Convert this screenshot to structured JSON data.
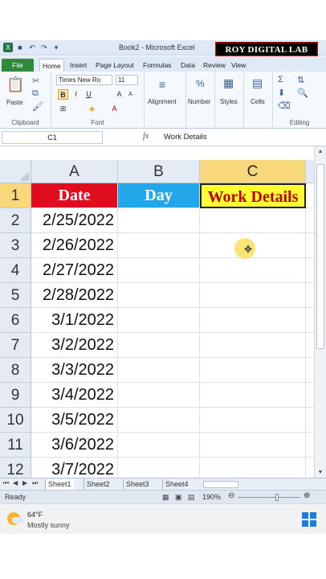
{
  "window": {
    "title": "Book2 - Microsoft Excel",
    "watermark": "ROY DIGITAL LAB"
  },
  "ribbon_tabs": [
    "File",
    "Home",
    "Insert",
    "Page Layout",
    "Formulas",
    "Data",
    "Review",
    "View"
  ],
  "ribbon": {
    "paste_label": "Paste",
    "clipboard_group": "Clipboard",
    "font_name": "Times New Ro",
    "font_size": "11",
    "font_group": "Font",
    "alignment_label": "Alignment",
    "number_label": "Number",
    "styles_label": "Styles",
    "cells_label": "Cells",
    "editing_group": "Editing"
  },
  "formula_bar": {
    "name_box": "C1",
    "fx": "fx",
    "content": "Work Details"
  },
  "columns": [
    "A",
    "B",
    "C"
  ],
  "rows": [
    "1",
    "2",
    "3",
    "4",
    "5",
    "6",
    "7",
    "8",
    "9",
    "10",
    "11",
    "12"
  ],
  "headers": {
    "a1": "Date",
    "b1": "Day",
    "c1": "Work Details"
  },
  "header_colors": {
    "a1_fill": "#e00d1e",
    "a1_text": "#ffffff",
    "b1_fill": "#22a7ea",
    "b1_text": "#ffffff",
    "c1_fill": "#ffff33",
    "c1_text": "#c00000"
  },
  "dates": [
    "2/25/2022",
    "2/26/2022",
    "2/27/2022",
    "2/28/2022",
    "3/1/2022",
    "3/2/2022",
    "3/3/2022",
    "3/4/2022",
    "3/5/2022",
    "3/6/2022",
    "3/7/2022"
  ],
  "sheets": [
    "Sheet1",
    "Sheet2",
    "Sheet3",
    "Sheet4"
  ],
  "status": {
    "ready": "Ready",
    "zoom": "190%"
  },
  "taskbar": {
    "temperature": "64°F",
    "condition": "Mostly sunny"
  }
}
